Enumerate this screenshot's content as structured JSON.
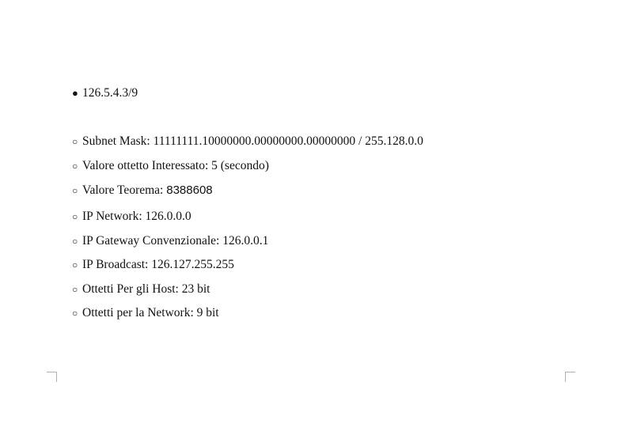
{
  "document": {
    "main_item": {
      "bullet": "●",
      "text": "126.5.4.3/9"
    },
    "sub_items": [
      {
        "bullet": "○",
        "label": "Subnet Mask: ",
        "value": "11111111.10000000.00000000.00000000 / 255.128.0.0"
      },
      {
        "bullet": "○",
        "label": "Valore ottetto Interessato: ",
        "value": "5 (secondo)"
      },
      {
        "bullet": "○",
        "label": "Valore Teorema: ",
        "value": "8388608"
      },
      {
        "bullet": "○",
        "label": "IP Network: ",
        "value": "126.0.0.0"
      },
      {
        "bullet": "○",
        "label": "IP Gateway Convenzionale: ",
        "value": "126.0.0.1"
      },
      {
        "bullet": "○",
        "label": "IP Broadcast: ",
        "value": "126.127.255.255"
      },
      {
        "bullet": "○",
        "label": "Ottetti Per gli Host: ",
        "value": "23 bit"
      },
      {
        "bullet": "○",
        "label": "Ottetti per la Network: ",
        "value": "9 bit"
      }
    ]
  }
}
